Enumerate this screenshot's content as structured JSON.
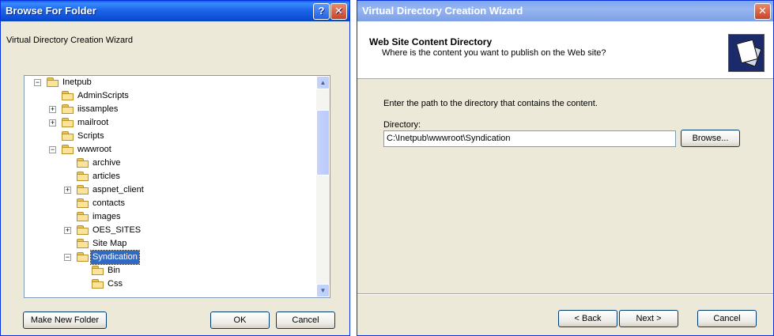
{
  "browse": {
    "title": "Browse For Folder",
    "help_btn": "?",
    "close_btn": "✕",
    "description": "Virtual Directory Creation Wizard",
    "tree": [
      {
        "label": "Inetpub",
        "level": 0,
        "expander": "−"
      },
      {
        "label": "AdminScripts",
        "level": 1,
        "expander": ""
      },
      {
        "label": "iissamples",
        "level": 1,
        "expander": "+"
      },
      {
        "label": "mailroot",
        "level": 1,
        "expander": "+"
      },
      {
        "label": "Scripts",
        "level": 1,
        "expander": ""
      },
      {
        "label": "wwwroot",
        "level": 1,
        "expander": "−"
      },
      {
        "label": "archive",
        "level": 2,
        "expander": ""
      },
      {
        "label": "articles",
        "level": 2,
        "expander": ""
      },
      {
        "label": "aspnet_client",
        "level": 2,
        "expander": "+"
      },
      {
        "label": "contacts",
        "level": 2,
        "expander": ""
      },
      {
        "label": "images",
        "level": 2,
        "expander": ""
      },
      {
        "label": "OES_SITES",
        "level": 2,
        "expander": "+"
      },
      {
        "label": "Site Map",
        "level": 2,
        "expander": ""
      },
      {
        "label": "Syndication",
        "level": 2,
        "expander": "−",
        "selected": true
      },
      {
        "label": "Bin",
        "level": 3,
        "expander": ""
      },
      {
        "label": "Css",
        "level": 3,
        "expander": ""
      }
    ],
    "make_new_folder": "Make New Folder",
    "ok": "OK",
    "cancel": "Cancel"
  },
  "wizard": {
    "title": "Virtual Directory Creation Wizard",
    "close_btn": "✕",
    "header_title": "Web Site Content Directory",
    "header_subtitle": "Where is the content you want to publish on the Web site?",
    "instruction": "Enter the path to the directory that contains the content.",
    "directory_label": "Directory:",
    "directory_value": "C:\\Inetpub\\wwwroot\\Syndication",
    "browse": "Browse...",
    "back": "< Back",
    "next": "Next >",
    "cancel": "Cancel"
  }
}
